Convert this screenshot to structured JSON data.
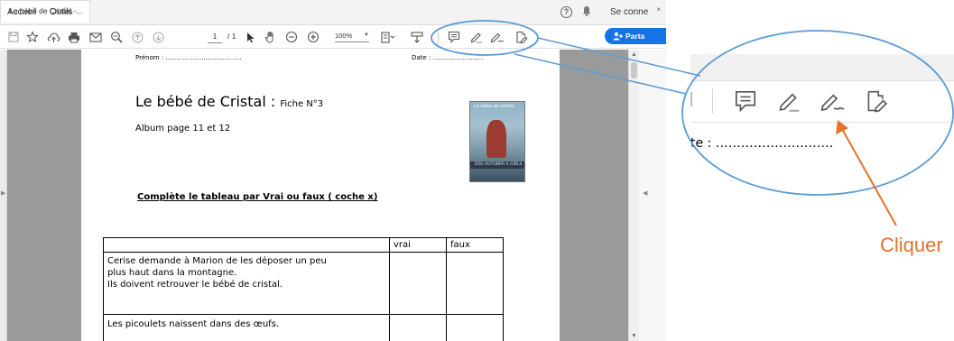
{
  "tabs": {
    "home": "Accueil",
    "tools": "Outils",
    "document": "Le bébé de Cristal -...",
    "close": "×"
  },
  "header": {
    "signin": "Se conne",
    "help": "?"
  },
  "toolbar": {
    "page_current": "1",
    "page_total": "/ 1",
    "zoom": "100%",
    "share_label": "Parta",
    "icons": [
      "save-icon",
      "bookmark-star-icon",
      "upload-cloud-icon",
      "print-icon",
      "email-icon",
      "search-zoom-icon",
      "page-up-icon",
      "page-down-icon",
      "select-arrow-icon",
      "hand-tool-icon",
      "zoom-out-icon",
      "zoom-in-icon",
      "fit-page-icon",
      "scroll-mode-icon",
      "comment-icon",
      "highlight-pen-icon",
      "sign-icon",
      "fill-sign-icon"
    ]
  },
  "document": {
    "prenom": "Prénom : ………………………………",
    "date": "Date : ……………………",
    "title": "Le bébé de Cristal : ",
    "fiche": "Fiche N°3",
    "subtitle": "Album page 11 et 12",
    "cover_title": "Le bébé de cristal",
    "cover_band": "ZOO AUTOBRR A GIRLS",
    "instruction": "Complète le tableau par Vrai ou faux  ( coche x)",
    "table": {
      "headers": [
        "",
        "vrai",
        "faux"
      ],
      "rows": [
        {
          "lines": [
            "Cerise demande à Marion de les déposer un peu",
            "plus haut dans la montagne.",
            "Ils doivent retrouver le bébé de cristal."
          ]
        },
        {
          "lines": [
            "Les picoulets naissent dans des œufs."
          ]
        }
      ]
    }
  },
  "callout": {
    "date_text": "te : ……………………….",
    "label": "Cliquer",
    "color": "#e6722b",
    "ellipse_color": "#5b9bd5"
  }
}
